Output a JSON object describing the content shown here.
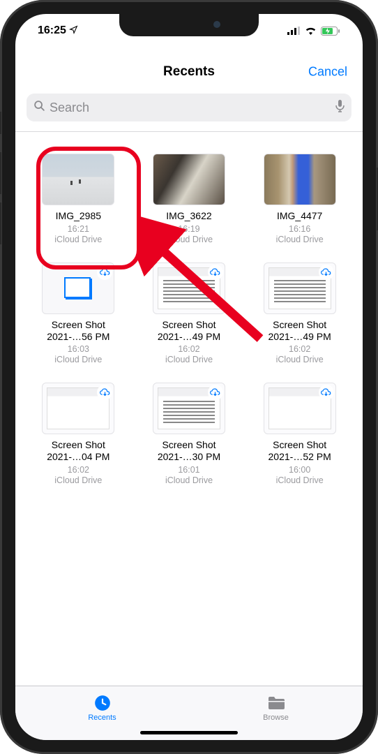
{
  "status": {
    "time": "16:25",
    "nav_glyph": "➤"
  },
  "nav": {
    "title": "Recents",
    "cancel": "Cancel"
  },
  "search": {
    "placeholder": "Search"
  },
  "files": [
    {
      "name": "IMG_2985",
      "time": "16:21",
      "loc": "iCloud Drive",
      "thumb": "snow",
      "cloud": false
    },
    {
      "name": "IMG_3622",
      "time": "16:19",
      "loc": "iCloud Drive",
      "thumb": "dog",
      "cloud": false
    },
    {
      "name": "IMG_4477",
      "time": "16:16",
      "loc": "iCloud Drive",
      "thumb": "person",
      "cloud": false
    },
    {
      "name": "Screen Shot 2021-…56 PM",
      "time": "16:03",
      "loc": "iCloud Drive",
      "thumb": "doc",
      "cloud": true
    },
    {
      "name": "Screen Shot 2021-…49 PM",
      "time": "16:02",
      "loc": "iCloud Drive",
      "thumb": "shot",
      "cloud": true
    },
    {
      "name": "Screen Shot 2021-…49 PM",
      "time": "16:02",
      "loc": "iCloud Drive",
      "thumb": "shot",
      "cloud": true
    },
    {
      "name": "Screen Shot 2021-…04 PM",
      "time": "16:02",
      "loc": "iCloud Drive",
      "thumb": "shot2",
      "cloud": true
    },
    {
      "name": "Screen Shot 2021-…30 PM",
      "time": "16:01",
      "loc": "iCloud Drive",
      "thumb": "shot",
      "cloud": true
    },
    {
      "name": "Screen Shot 2021-…52 PM",
      "time": "16:00",
      "loc": "iCloud Drive",
      "thumb": "shot2",
      "cloud": true
    }
  ],
  "tabs": {
    "recents": "Recents",
    "browse": "Browse"
  }
}
